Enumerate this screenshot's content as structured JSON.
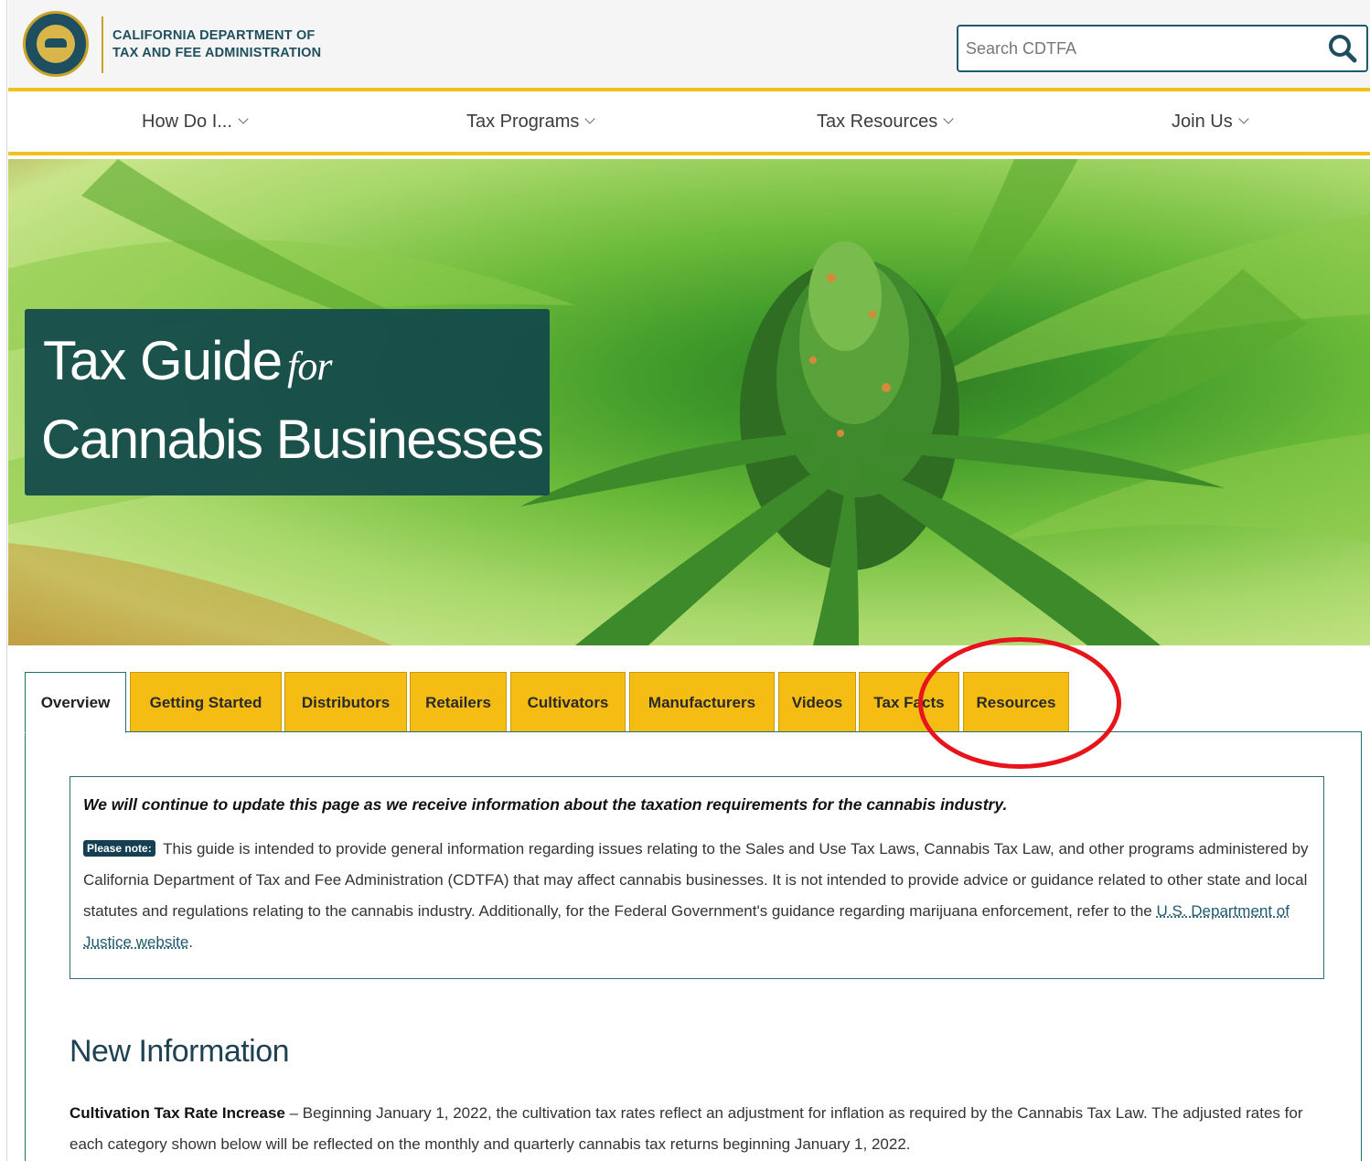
{
  "header": {
    "org_line1": "CALIFORNIA DEPARTMENT OF",
    "org_line2": "TAX AND FEE ADMINISTRATION",
    "search_placeholder": "Search CDTFA"
  },
  "nav": {
    "items": [
      {
        "label": "How Do I..."
      },
      {
        "label": "Tax Programs"
      },
      {
        "label": "Tax Resources"
      },
      {
        "label": "Join Us"
      }
    ]
  },
  "hero": {
    "line1": "Tax Guide",
    "for": "for",
    "line2": "Cannabis Businesses"
  },
  "tabs": [
    {
      "label": "Overview",
      "active": true
    },
    {
      "label": "Getting Started"
    },
    {
      "label": "Distributors"
    },
    {
      "label": "Retailers"
    },
    {
      "label": "Cultivators"
    },
    {
      "label": "Manufacturers"
    },
    {
      "label": "Videos"
    },
    {
      "label": "Tax Facts"
    },
    {
      "label": "Resources"
    }
  ],
  "notice": {
    "heading": "We will continue to update this page as we receive information about the taxation requirements for the cannabis industry.",
    "badge": "Please note:",
    "body": "This guide is intended to provide general information regarding issues relating to the Sales and Use Tax Laws, Cannabis Tax Law, and other programs administered by California Department of Tax and Fee Administration (CDTFA) that may affect cannabis businesses. It is not intended to provide advice or guidance related to other state and local statutes and regulations relating to the cannabis industry. Additionally, for the Federal Government's guidance regarding marijuana enforcement, refer to the",
    "link": "U.S. Department of Justice website",
    "end": "."
  },
  "new_info": {
    "title": "New Information",
    "lead": "Cultivation Tax Rate Increase",
    "dash": " – ",
    "text": "Beginning January 1, 2022, the cultivation tax rates reflect an adjustment for inflation as required by the Cannabis Tax Law. The adjusted rates for each category shown below will be reflected on the monthly and quarterly cannabis tax returns beginning January 1, 2022."
  },
  "colors": {
    "accent_yellow": "#f3c01a",
    "teal_dark": "#11484a",
    "annotation_red": "#e8141b"
  }
}
